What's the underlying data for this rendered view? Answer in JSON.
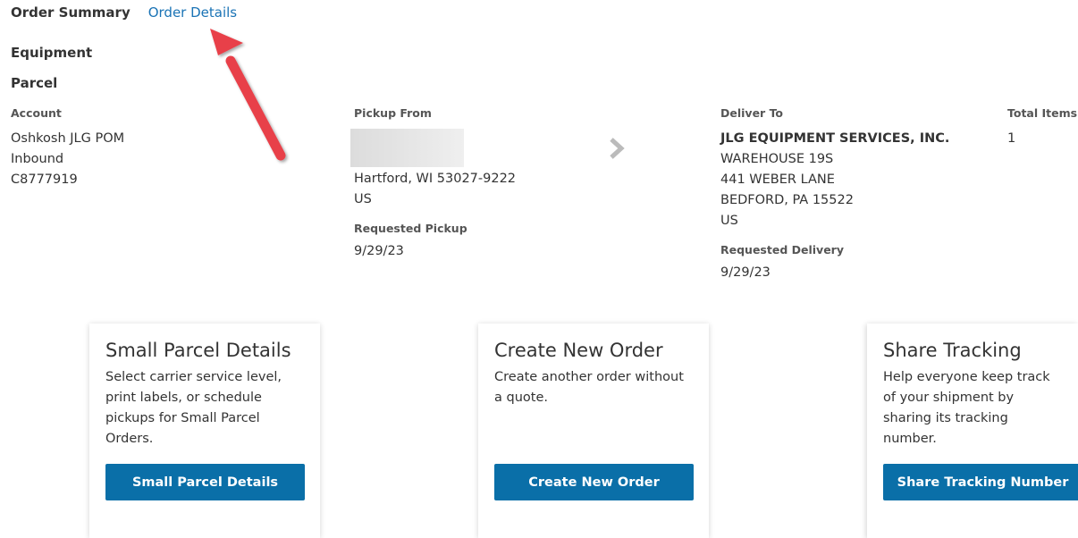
{
  "tabs": {
    "summary": "Order Summary",
    "details": "Order Details"
  },
  "sections": {
    "equipment": "Equipment",
    "parcel": "Parcel"
  },
  "account": {
    "label": "Account",
    "lines": [
      "Oshkosh JLG POM",
      "Inbound",
      "C8777919"
    ]
  },
  "pickup": {
    "label": "Pickup From",
    "city": "Hartford, WI 53027-9222",
    "country": "US",
    "requested_label": "Requested Pickup",
    "requested_date": "9/29/23"
  },
  "deliver": {
    "label": "Deliver To",
    "company": "JLG EQUIPMENT SERVICES, INC.",
    "line1": "WAREHOUSE 19S",
    "line2": "441 WEBER LANE",
    "line3": "BEDFORD, PA 15522",
    "country": "US",
    "requested_label": "Requested Delivery",
    "requested_date": "9/29/23"
  },
  "total": {
    "label": "Total Items",
    "value": "1"
  },
  "cards": [
    {
      "title": "Small Parcel Details",
      "description": "Select carrier service level, print labels, or schedule pickups for Small Parcel Orders.",
      "button": "Small Parcel Details"
    },
    {
      "title": "Create New Order",
      "description": "Create another order without a quote.",
      "button": "Create New Order"
    },
    {
      "title": "Share Tracking",
      "description": "Help everyone keep track of your shipment by sharing its tracking number.",
      "button": "Share Tracking Number"
    }
  ],
  "colors": {
    "link": "#1a73b5",
    "button": "#0a6fa8",
    "annotation_arrow": "#e8414a"
  },
  "icons": {
    "route_separator": "chevron-right-icon",
    "annotation": "red-arrow-pointer"
  }
}
